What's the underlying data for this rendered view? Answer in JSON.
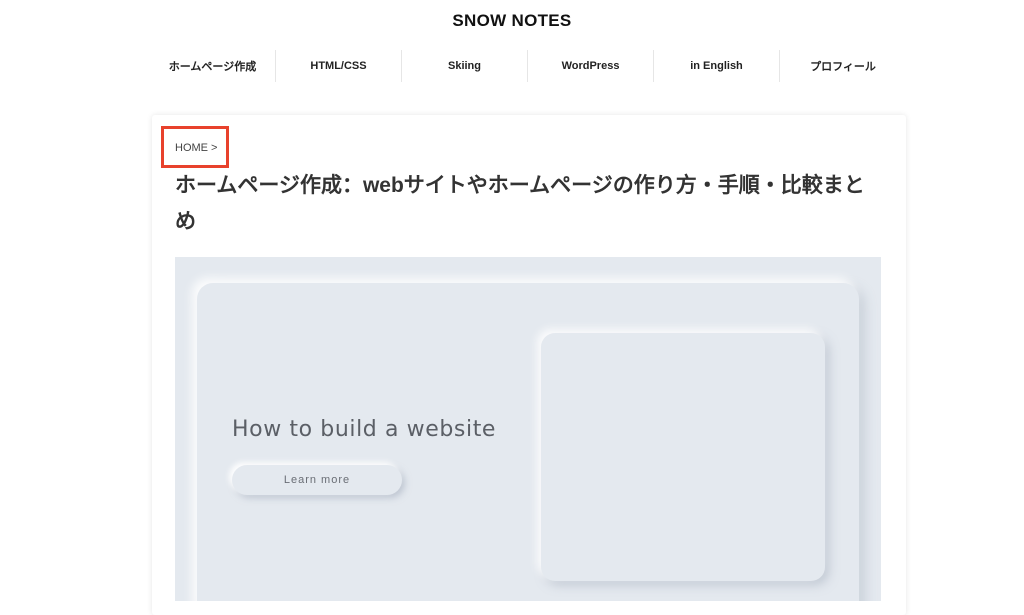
{
  "site": {
    "title": "SNOW NOTES"
  },
  "nav": {
    "items": [
      {
        "label": "ホームページ作成"
      },
      {
        "label": "HTML/CSS"
      },
      {
        "label": "Skiing"
      },
      {
        "label": "WordPress"
      },
      {
        "label": "in English"
      },
      {
        "label": "プロフィール"
      }
    ]
  },
  "breadcrumb": {
    "home": "HOME >"
  },
  "article": {
    "title": "ホームページ作成：webサイトやホームページの作り方・手順・比較まとめ"
  },
  "hero": {
    "heading": "How to build a website",
    "button_label": "Learn more"
  },
  "colors": {
    "highlight_border": "#e8412c",
    "hero_background": "#e4e9ef"
  }
}
